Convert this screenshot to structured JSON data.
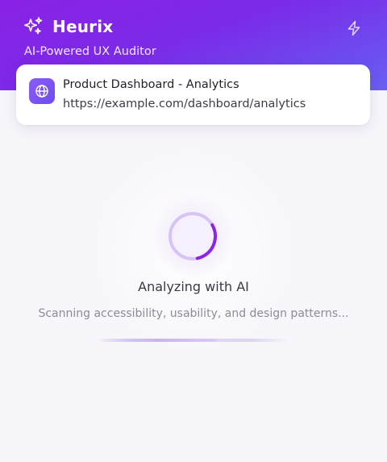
{
  "app": {
    "name": "Heurix",
    "tagline": "AI-Powered UX Auditor",
    "logo_icon": "sparkles-icon",
    "action_icon": "lightning-bolt-icon"
  },
  "target": {
    "title": "Product Dashboard - Analytics",
    "url": "https://example.com/dashboard/analytics",
    "icon": "globe-icon"
  },
  "status": {
    "title": "Analyzing with AI",
    "subtitle": "Scanning accessibility, usability, and design patterns...",
    "spinner_progress": 0.3,
    "bar_progress": 0.62
  },
  "colors": {
    "header_start": "#8a22e6",
    "header_end": "#6a5ff2",
    "accent": "#8b26e8",
    "spinner_track": "#d7c3f7"
  }
}
